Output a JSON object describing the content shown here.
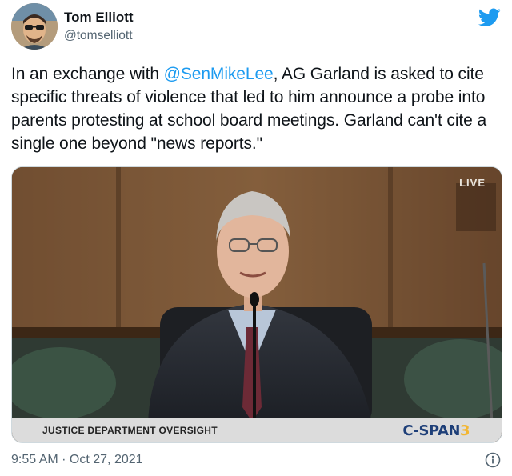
{
  "author": {
    "name": "Tom Elliott",
    "handle": "@tomselliott"
  },
  "tweet": {
    "text_before": "In an exchange with ",
    "mention": "@SenMikeLee",
    "text_after": ", AG Garland is asked to cite specific threats of violence that led to him announce a probe into parents protesting at school board meetings. Garland can't cite a single one beyond \"news reports.\""
  },
  "video": {
    "live_label": "LIVE",
    "caption": "JUSTICE DEPARTMENT OVERSIGHT",
    "network_prefix": "C-SPAN",
    "network_number": "3"
  },
  "meta": {
    "timestamp": "9:55 AM · Oct 27, 2021"
  },
  "icons": {
    "brand": "twitter-bird-icon",
    "info": "info-icon"
  },
  "colors": {
    "link": "#1d9bf0",
    "twitter_blue": "#1d9bf0",
    "secondary_text": "#536471"
  }
}
